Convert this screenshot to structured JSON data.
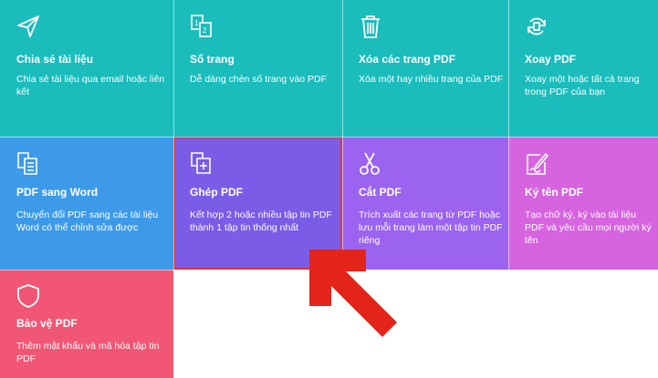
{
  "colors": {
    "teal": "#1bbcbc",
    "blue": "#3d9ae8",
    "indigo": "#7b5ce6",
    "purple": "#9b63ef",
    "magenta": "#d664df",
    "pink": "#f15675",
    "highlight_border": "#d9363e",
    "arrow": "#e3241b"
  },
  "tools": [
    {
      "id": "share",
      "icon": "paper-plane-icon",
      "title": "Chia sẻ tài liệu",
      "desc": "Chia sẻ tài liệu qua email hoặc liên kết"
    },
    {
      "id": "page-numbers",
      "icon": "page-number-icon",
      "title": "Số trang",
      "desc": "Dễ dàng chèn số trang vào PDF"
    },
    {
      "id": "delete-pages",
      "icon": "trash-icon",
      "title": "Xóa các trang PDF",
      "desc": "Xóa một hay nhiều trang của PDF"
    },
    {
      "id": "rotate",
      "icon": "rotate-icon",
      "title": "Xoay PDF",
      "desc": "Xoay một hoặc tất cả trang trong PDF của bạn"
    },
    {
      "id": "pdf-to-word",
      "icon": "pdf-to-word-icon",
      "title": "PDF sang Word",
      "desc": "Chuyển đổi PDF sang các tài liệu Word có thể chỉnh sửa được"
    },
    {
      "id": "merge",
      "icon": "merge-icon",
      "title": "Ghép PDF",
      "desc": "Kết hợp 2 hoặc nhiều tập tin PDF thành 1 tập tin thống nhất"
    },
    {
      "id": "split",
      "icon": "scissors-icon",
      "title": "Cắt PDF",
      "desc": "Trích xuất các trang từ PDF hoặc lưu mỗi trang làm một tập tin PDF riêng"
    },
    {
      "id": "sign",
      "icon": "signature-icon",
      "title": "Ký tên PDF",
      "desc": "Tạo chữ ký, ký vào tài liệu PDF và yêu cầu mọi người ký tên"
    },
    {
      "id": "protect",
      "icon": "shield-icon",
      "title": "Bảo vệ PDF",
      "desc": "Thêm mật khẩu và mã hóa tập tin PDF"
    }
  ]
}
